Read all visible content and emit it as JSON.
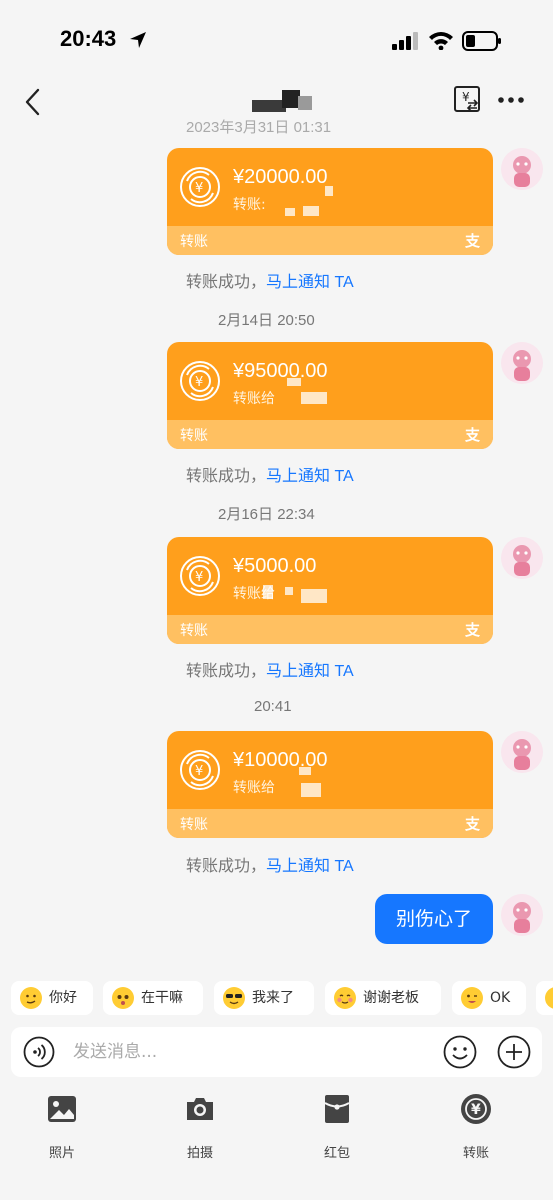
{
  "status_bar": {
    "time": "20:43"
  },
  "header": {
    "title_hidden": true
  },
  "chat": {
    "partial_timestamp": "2023年3月31日 01:31",
    "transfers": [
      {
        "amount": "¥20000.00",
        "subtitle": "转账:",
        "type_label": "转账",
        "pay_mark": "支"
      },
      {
        "amount": "¥95000.00",
        "subtitle": "转账给",
        "type_label": "转账",
        "pay_mark": "支"
      },
      {
        "amount": "¥5000.00",
        "subtitle": "转账给",
        "type_label": "转账",
        "pay_mark": "支"
      },
      {
        "amount": "¥10000.00",
        "subtitle": "转账给",
        "type_label": "转账",
        "pay_mark": "支"
      }
    ],
    "notice_text": "转账成功，",
    "notice_link": "马上通知 TA",
    "timestamps": [
      "2月14日 20:50",
      "2月16日 22:34",
      "20:41"
    ],
    "my_message": "别伤心了"
  },
  "quick_replies": [
    {
      "label": "你好",
      "icon": "thinking-emoji-icon"
    },
    {
      "label": "在干嘛",
      "icon": "curious-emoji-icon"
    },
    {
      "label": "我来了",
      "icon": "sunglasses-emoji-icon"
    },
    {
      "label": "谢谢老板",
      "icon": "blushing-emoji-icon"
    },
    {
      "label": "OK",
      "icon": "wink-emoji-icon"
    }
  ],
  "input": {
    "placeholder": "发送消息..."
  },
  "toolbar": {
    "items": [
      {
        "label": "照片",
        "icon": "photo-icon"
      },
      {
        "label": "拍摄",
        "icon": "camera-icon"
      },
      {
        "label": "红包",
        "icon": "red-packet-icon"
      },
      {
        "label": "转账",
        "icon": "transfer-icon"
      }
    ]
  },
  "colors": {
    "accent": "#1677ff",
    "transfer_card": "#ff9f1c",
    "transfer_card_footer": "#ffc061",
    "background": "#f5f5f5"
  }
}
